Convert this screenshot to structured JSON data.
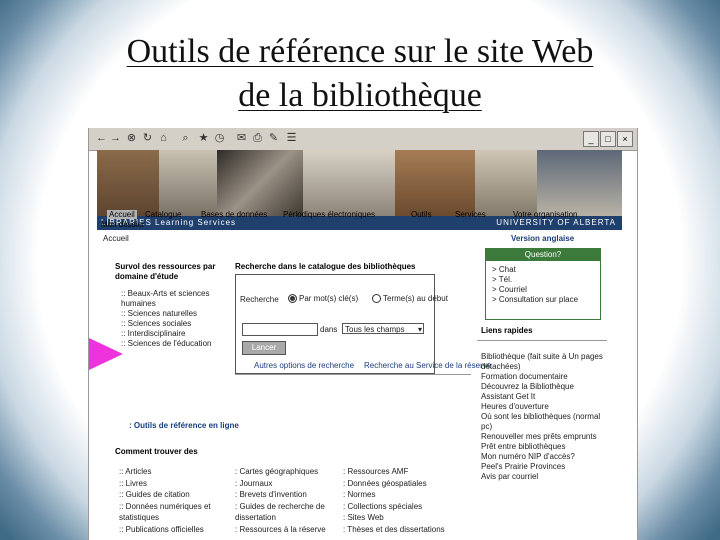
{
  "slide": {
    "title_line1": "Outils de référence sur le site Web",
    "title_line2": "de la bibliothèque"
  },
  "banner": {
    "left_text": "LIBRARIES   Learning Services",
    "right_text": "UNIVERSITY OF ALBERTA"
  },
  "nav": {
    "items": [
      "Accueil",
      "Catalogue",
      "Bases de données",
      "Périodiques électroniques",
      "Outils",
      "Services",
      "Votre organisation",
      "Mon dossier"
    ]
  },
  "breadcrumb": "Accueil",
  "left": {
    "heading": "Survol des ressources par domaine d'étude",
    "items": [
      ":: Beaux-Arts et sciences humaines",
      ":: Sciences naturelles",
      ":: Sciences sociales",
      ":: Interdisciplinaire",
      ":: Sciences de l'éducation"
    ]
  },
  "search": {
    "heading": "Recherche dans le catalogue des bibliothèques",
    "label_search": "Recherche",
    "opt1": "Par mot(s) clé(s)",
    "opt2": "Terme(s) au début",
    "label_in": "dans",
    "select_value": "Tous les champs",
    "button": "Lancer",
    "more_options": "Autres options de recherche",
    "reserve": "Recherche au Service de la réserve"
  },
  "right": {
    "english": "Version anglaise",
    "question_head": "Question?",
    "question_items": [
      "> Chat",
      "> Tél.",
      "> Courriel",
      "> Consultation sur place"
    ],
    "quick_links_head": "Liens rapides",
    "quick_links": [
      "Bibliothèque (fait suite à Un pages détachées)",
      "Formation documentaire",
      "Découvrez la Bibliothèque",
      "Assistant Get It",
      "Heures d'ouverture",
      "Où sont les bibliothèques (normal pc)",
      "Renouveller mes prêts emprunts",
      "Prêt entre bibliothèques",
      "Mon numéro NIP d'accès?",
      "Peel's Prairie Provinces",
      "Avis par courriel"
    ]
  },
  "tools": {
    "link": ": Outils de référence en ligne"
  },
  "how": {
    "heading": "Comment trouver des",
    "col1": [
      ":: Articles",
      ":: Livres",
      ":: Guides de citation",
      ":: Données numériques et statistiques",
      ":: Publications officielles"
    ],
    "col2": [
      ": Cartes géographiques",
      ": Journaux",
      ": Brevets d'invention",
      ": Guides de recherche de dissertation",
      ": Ressources à la réserve"
    ],
    "col3": [
      ": Ressources AMF",
      ": Données géospatiales",
      ": Normes",
      ": Collections spéciales",
      ": Sites Web",
      ": Thèses et des dissertations"
    ]
  },
  "colors": {
    "band": "#1f3f6c",
    "arrow": "#ee33dd",
    "green": "#3b7a3b"
  }
}
